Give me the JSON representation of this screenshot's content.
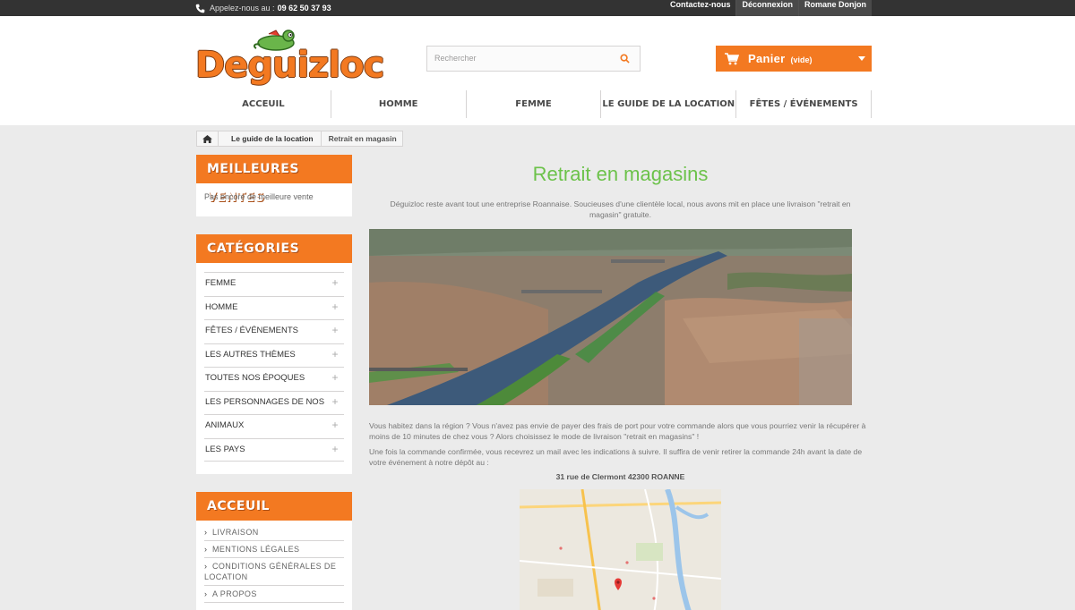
{
  "topbar": {
    "phone_prefix": "Appelez-nous au :",
    "phone_number": "09 62 50 37 93",
    "links": [
      "Contactez-nous",
      "Déconnexion",
      "Romane Donjon"
    ]
  },
  "header": {
    "logo_text": "Deguizloc",
    "search_placeholder": "Rechercher",
    "cart_label": "Panier",
    "cart_status": "(vide)"
  },
  "nav": [
    "ACCEUIL",
    "HOMME",
    "FEMME",
    "LE GUIDE DE LA LOCATION",
    "FÊTES / ÉVÉNEMENTS"
  ],
  "breadcrumb": {
    "parent": "Le guide de la location",
    "current": "Retrait en magasin"
  },
  "sidebar": {
    "bestsellers": {
      "title": "MEILLEURES VENTES",
      "empty_text": "Pas encore de meilleure vente"
    },
    "categories": {
      "title": "CATÉGORIES",
      "items": [
        "FEMME",
        "HOMME",
        "FÊTES / ÉVÉNEMENTS",
        "LES AUTRES THÈMES",
        "TOUTES NOS ÉPOQUES",
        "LES PERSONNAGES DE NOS ÉCRANS",
        "ANIMAUX",
        "LES PAYS"
      ]
    },
    "acceuil": {
      "title": "ACCEUIL",
      "items": [
        "LIVRAISON",
        "MENTIONS LÉGALES",
        "CONDITIONS GÉNÉRALES DE LOCATION",
        "A PROPOS"
      ]
    }
  },
  "main": {
    "title": "Retrait en magasins",
    "intro": "Déguizloc reste avant tout une entreprise Roannaise. Soucieuses d'une clientèle local, nous avons mit en place une livraison \"retrait en magasin\" gratuite.",
    "paragraph1": "Vous habitez dans la région ? Vous n'avez pas envie de payer des frais de port pour votre commande alors que vous pourriez venir la récupérer à moins de 10 minutes de chez vous ? Alors choisissez le mode de livraison \"retrait en magasins\" !",
    "paragraph2": "Une fois la commande confirmée, vous recevrez un mail avec les indications à suivre. Il suffira de venir retirer la commande 24h avant la date de votre événement à notre dépôt au :",
    "address": "31 rue de Clermont 42300 ROANNE"
  },
  "colors": {
    "accent": "#f37921",
    "title_green": "#6cc24a",
    "topbar": "#333333"
  }
}
